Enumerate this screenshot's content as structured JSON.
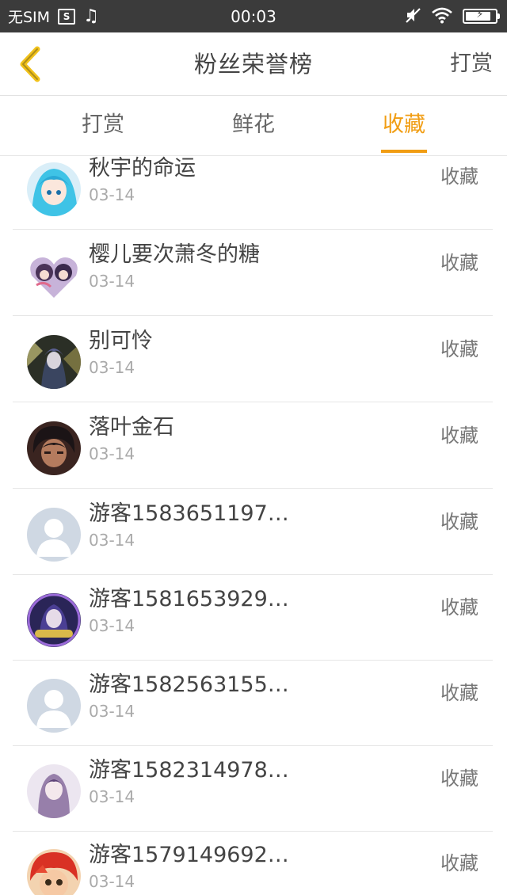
{
  "status_bar": {
    "carrier": "无SIM",
    "time": "00:03",
    "sim_icon_text": "S",
    "battery_level": 0.85,
    "icons": [
      "sim-card-icon",
      "music-note-icon",
      "mute-icon",
      "wifi-icon",
      "battery-charging-icon"
    ]
  },
  "header": {
    "title": "粉丝荣誉榜",
    "action_label": "打赏",
    "back_icon": "back-chevron-icon"
  },
  "tabs": [
    {
      "label": "打赏",
      "active": false
    },
    {
      "label": "鲜花",
      "active": false
    },
    {
      "label": "收藏",
      "active": true
    }
  ],
  "colors": {
    "accent": "#f19d13",
    "status_bar": "#3b3b3b",
    "divider": "#e6e6e6"
  },
  "list": [
    {
      "name": "秋宇的命运",
      "date": "03-14",
      "action": "收藏",
      "avatar": "anime-blue-hair-avatar"
    },
    {
      "name": "樱儿要次萧冬的糖",
      "date": "03-14",
      "action": "收藏",
      "avatar": "anime-heart-avatar"
    },
    {
      "name": "别可怜",
      "date": "03-14",
      "action": "收藏",
      "avatar": "anime-dark-avatar"
    },
    {
      "name": "落叶金石",
      "date": "03-14",
      "action": "收藏",
      "avatar": "anime-dark-hair-avatar"
    },
    {
      "name": "游客1583651197…",
      "date": "03-14",
      "action": "收藏",
      "avatar": "default-user-avatar"
    },
    {
      "name": "游客1581653929…",
      "date": "03-14",
      "action": "收藏",
      "avatar": "anime-badge-avatar"
    },
    {
      "name": "游客1582563155…",
      "date": "03-14",
      "action": "收藏",
      "avatar": "default-user-avatar"
    },
    {
      "name": "游客1582314978…",
      "date": "03-14",
      "action": "收藏",
      "avatar": "anime-purple-avatar"
    },
    {
      "name": "游客1579149692…",
      "date": "03-14",
      "action": "收藏",
      "avatar": "anime-red-hair-avatar"
    }
  ]
}
